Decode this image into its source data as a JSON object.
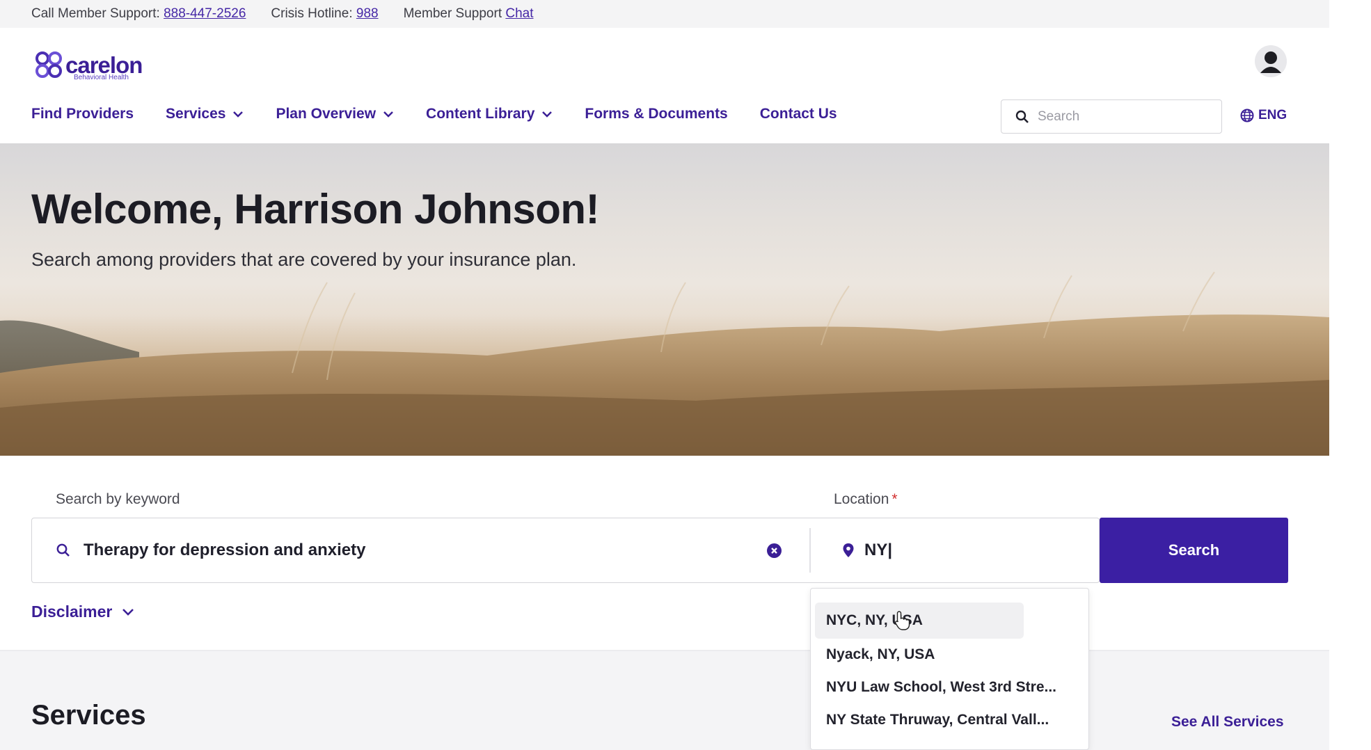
{
  "utility_bar": {
    "member_support_label": "Call Member Support:",
    "member_support_phone": "888-447-2526",
    "crisis_label": "Crisis Hotline:",
    "crisis_phone": "988",
    "chat_label": "Member Support",
    "chat_link": "Chat"
  },
  "header": {
    "logo_text": "carelon",
    "logo_subtext": "Behavioral Health",
    "search_placeholder": "Search",
    "language": "ENG",
    "avatar_icon": "user-avatar-icon"
  },
  "nav": {
    "items": [
      {
        "label": "Find Providers",
        "has_dropdown": false
      },
      {
        "label": "Services",
        "has_dropdown": true
      },
      {
        "label": "Plan Overview",
        "has_dropdown": true
      },
      {
        "label": "Content Library",
        "has_dropdown": true
      },
      {
        "label": "Forms & Documents",
        "has_dropdown": false
      },
      {
        "label": "Contact Us",
        "has_dropdown": false
      }
    ]
  },
  "hero": {
    "title": "Welcome, Harrison Johnson!",
    "subtitle": "Search among providers that are covered by your insurance plan."
  },
  "search": {
    "keyword_label": "Search by keyword",
    "keyword_value": "Therapy for depression and anxiety",
    "location_label": "Location",
    "location_required_marker": "*",
    "location_value": "NY|",
    "button_label": "Search"
  },
  "disclaimer": {
    "label": "Disclaimer"
  },
  "location_suggestions": {
    "items": [
      "NYC, NY, USA",
      "Nyack, NY, USA",
      "NYU Law School, West 3rd Stre...",
      "NY State Thruway, Central Vall..."
    ],
    "highlighted_index": 0
  },
  "services": {
    "title": "Services",
    "see_all_label": "See All Services"
  },
  "colors": {
    "brand_purple": "#3b1f96",
    "button_purple": "#3b1fa3",
    "required_red": "#d12d2d"
  }
}
